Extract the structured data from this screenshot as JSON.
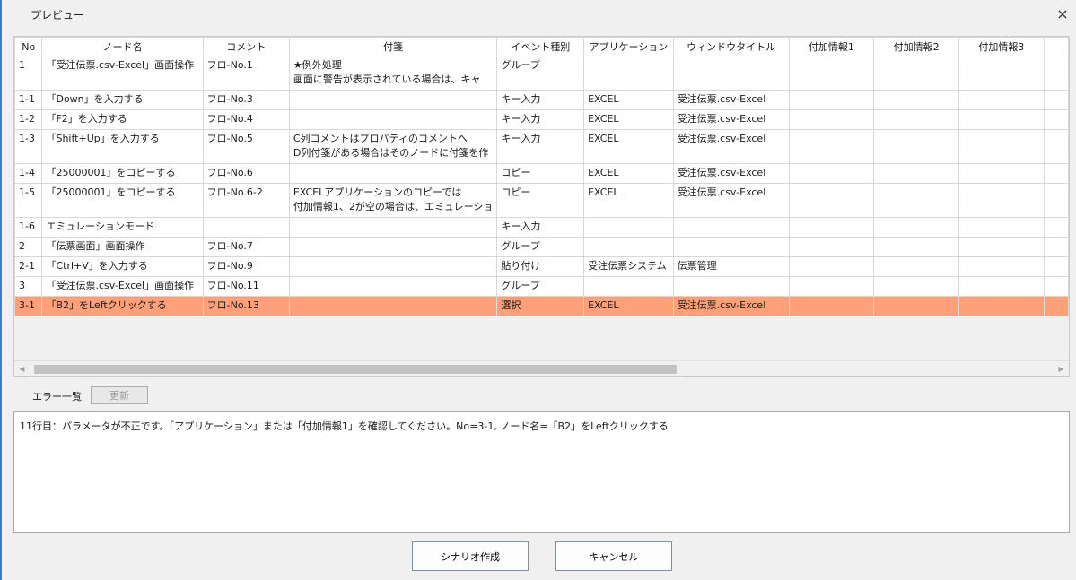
{
  "window": {
    "title": "プレビュー",
    "close_icon": "×"
  },
  "grid": {
    "columns": [
      "No",
      "ノード名",
      "コメント",
      "付箋",
      "イベント種別",
      "アプリケーション",
      "ウィンドウタイトル",
      "付加情報1",
      "付加情報2",
      "付加情報3"
    ],
    "rows": [
      {
        "no": "1",
        "node": "「受注伝票.csv-Excel」画面操作",
        "comment": "フロ-No.1",
        "note": "★例外処理\n画面に警告が表示されている場合は、キャ",
        "event": "グループ",
        "app": "",
        "window": ""
      },
      {
        "no": "1-1",
        "node": "「Down」を入力する",
        "comment": "フロ-No.3",
        "note": "",
        "event": "キー入力",
        "app": "EXCEL",
        "window": "受注伝票.csv-Excel"
      },
      {
        "no": "1-2",
        "node": "「F2」を入力する",
        "comment": "フロ-No.4",
        "note": "",
        "event": "キー入力",
        "app": "EXCEL",
        "window": "受注伝票.csv-Excel"
      },
      {
        "no": "1-3",
        "node": "「Shift+Up」を入力する",
        "comment": "フロ-No.5",
        "note": "C列コメントはプロパティのコメントへ\nD列付箋がある場合はそのノードに付箋を作",
        "event": "キー入力",
        "app": "EXCEL",
        "window": "受注伝票.csv-Excel"
      },
      {
        "no": "1-4",
        "node": "「25000001」をコピーする",
        "comment": "フロ-No.6",
        "note": "",
        "event": "コピー",
        "app": "EXCEL",
        "window": "受注伝票.csv-Excel"
      },
      {
        "no": "1-5",
        "node": "「25000001」をコピーする",
        "comment": "フロ-No.6-2",
        "note": "EXCELアプリケーションのコピーでは\n付加情報1、2が空の場合は、エミュレーショ",
        "event": "コピー",
        "app": "EXCEL",
        "window": "受注伝票.csv-Excel"
      },
      {
        "no": "1-6",
        "node": "エミュレーションモード",
        "comment": "",
        "note": "",
        "event": "キー入力",
        "app": "",
        "window": ""
      },
      {
        "no": "2",
        "node": "「伝票画面」画面操作",
        "comment": "フロ-No.7",
        "note": "",
        "event": "グループ",
        "app": "",
        "window": ""
      },
      {
        "no": "2-1",
        "node": "「Ctrl+V」を入力する",
        "comment": "フロ-No.9",
        "note": "",
        "event": "貼り付け",
        "app": "受注伝票システム",
        "window": "伝票管理"
      },
      {
        "no": "3",
        "node": "「受注伝票.csv-Excel」画面操作",
        "comment": "フロ-No.11",
        "note": "",
        "event": "グループ",
        "app": "",
        "window": ""
      },
      {
        "no": "3-1",
        "node": "「B2」をLeftクリックする",
        "comment": "フロ-No.13",
        "note": "",
        "event": "選択",
        "app": "EXCEL",
        "window": "受注伝票.csv-Excel"
      }
    ],
    "selected_row_color": "#ffa07a"
  },
  "errors": {
    "label": "エラー一覧",
    "refresh_label": "更新",
    "message": "11行目：パラメータが不正です。「アプリケーション」または「付加情報1」を確認してください。No=3-1, ノード名=「B2」をLeftクリックする"
  },
  "buttons": {
    "create": "シナリオ作成",
    "cancel": "キャンセル"
  }
}
